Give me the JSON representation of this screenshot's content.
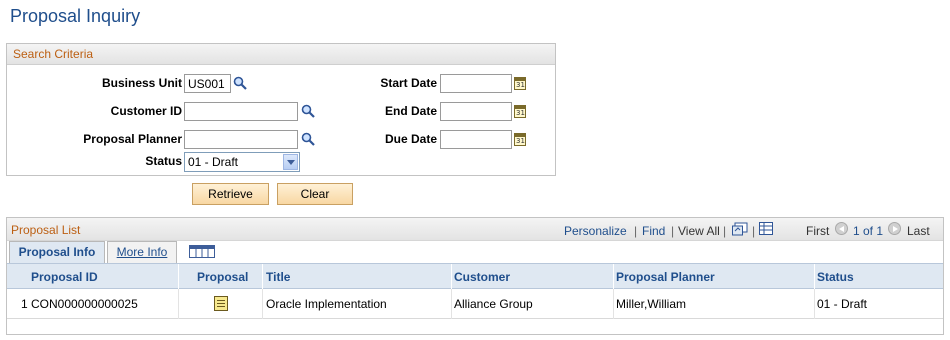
{
  "page": {
    "title": "Proposal Inquiry"
  },
  "search": {
    "section_title": "Search Criteria",
    "business_unit": {
      "label": "Business Unit",
      "value": "US001"
    },
    "customer_id": {
      "label": "Customer ID",
      "value": ""
    },
    "proposal_planner": {
      "label": "Proposal Planner",
      "value": ""
    },
    "status": {
      "label": "Status",
      "value": "01 - Draft"
    },
    "start_date": {
      "label": "Start Date",
      "value": ""
    },
    "end_date": {
      "label": "End Date",
      "value": ""
    },
    "due_date": {
      "label": "Due Date",
      "value": ""
    },
    "calendar_glyph": "31"
  },
  "buttons": {
    "retrieve": "Retrieve",
    "clear": "Clear"
  },
  "grid": {
    "title": "Proposal List",
    "personalize": "Personalize",
    "find": "Find",
    "view_all": "View All",
    "sep": "|",
    "first": "First",
    "range": "1 of 1",
    "last": "Last",
    "tabs": [
      "Proposal Info",
      "More Info"
    ],
    "columns": [
      "Proposal ID",
      "Proposal",
      "Title",
      "Customer",
      "Proposal Planner",
      "Status"
    ],
    "rows": [
      {
        "num": "1",
        "proposal_id": "CON000000000025",
        "title": "Oracle Implementation",
        "customer": "Alliance Group",
        "planner": "Miller,William",
        "status": "01 - Draft"
      }
    ]
  },
  "colors": {
    "title_blue": "#1f4e8c",
    "section_orange": "#bc5f12",
    "button_fill": "#f8d7a3"
  }
}
